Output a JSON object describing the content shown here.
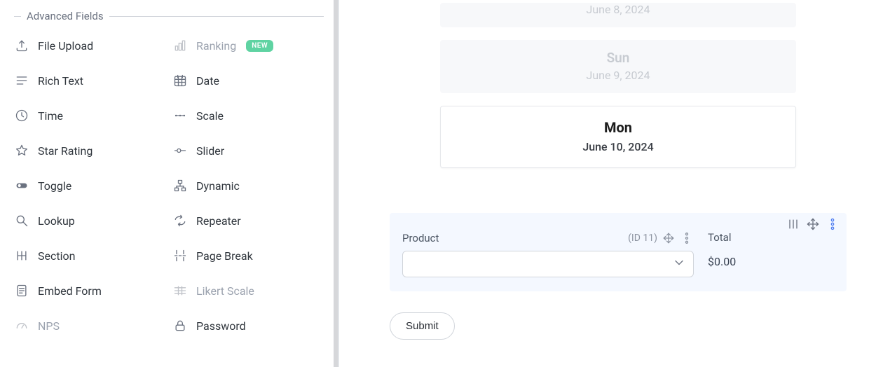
{
  "sidebar": {
    "section_label": "Advanced Fields",
    "new_badge": "NEW",
    "items": [
      {
        "label": "File Upload",
        "icon": "upload-icon"
      },
      {
        "label": "Ranking",
        "icon": "ranking-icon",
        "disabled": true,
        "badge": true
      },
      {
        "label": "Rich Text",
        "icon": "richtext-icon"
      },
      {
        "label": "Date",
        "icon": "calendar-icon"
      },
      {
        "label": "Time",
        "icon": "clock-icon"
      },
      {
        "label": "Scale",
        "icon": "scale-icon"
      },
      {
        "label": "Star Rating",
        "icon": "star-icon"
      },
      {
        "label": "Slider",
        "icon": "slider-icon"
      },
      {
        "label": "Toggle",
        "icon": "toggle-icon"
      },
      {
        "label": "Dynamic",
        "icon": "dynamic-icon"
      },
      {
        "label": "Lookup",
        "icon": "search-icon"
      },
      {
        "label": "Repeater",
        "icon": "repeater-icon"
      },
      {
        "label": "Section",
        "icon": "section-icon"
      },
      {
        "label": "Page Break",
        "icon": "pagebreak-icon"
      },
      {
        "label": "Embed Form",
        "icon": "embed-icon"
      },
      {
        "label": "Likert Scale",
        "icon": "likert-icon",
        "disabled": true
      },
      {
        "label": "NPS",
        "icon": "gauge-icon",
        "disabled": true
      },
      {
        "label": "Password",
        "icon": "lock-icon"
      }
    ]
  },
  "days": {
    "sat": {
      "name": "",
      "date": "June 8, 2024"
    },
    "sun": {
      "name": "Sun",
      "date": "June 9, 2024"
    },
    "mon": {
      "name": "Mon",
      "date": "June 10, 2024"
    }
  },
  "product": {
    "label": "Product",
    "id_label": "(ID 11)",
    "total_label": "Total",
    "total_value": "$0.00"
  },
  "submit_label": "Submit"
}
